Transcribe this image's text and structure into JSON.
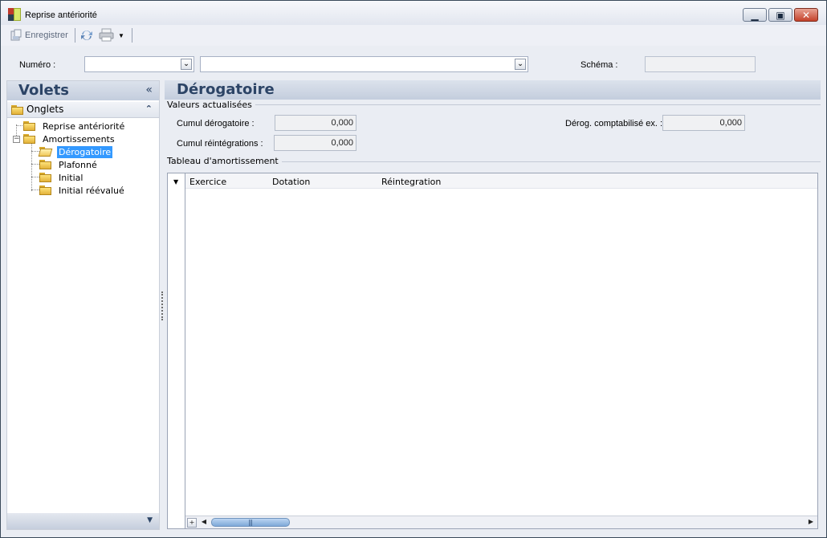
{
  "window": {
    "title": "Reprise antériorité"
  },
  "toolbar": {
    "save_label": "Enregistrer"
  },
  "header": {
    "numero_label": "Numéro :",
    "numero_value": "",
    "numero_desc_value": "",
    "schema_label": "Schéma :",
    "schema_value": ""
  },
  "left_pane": {
    "title": "Volets",
    "collapse_glyph": "«",
    "section_title": "Onglets",
    "section_glyph": "⌃",
    "tree": [
      {
        "label": "Reprise antériorité"
      },
      {
        "label": "Amortissements"
      },
      {
        "label": "Dérogatoire",
        "selected": true
      },
      {
        "label": "Plafonné"
      },
      {
        "label": "Initial"
      },
      {
        "label": "Initial réévalué"
      }
    ]
  },
  "main": {
    "title": "Dérogatoire",
    "valeurs_group": "Valeurs actualisées",
    "cumul_derog_label": "Cumul dérogatoire :",
    "cumul_derog_value": "0,000",
    "derog_compta_label": "Dérog. comptabilisé ex. :",
    "derog_compta_value": "0,000",
    "cumul_reint_label": "Cumul réintégrations :",
    "cumul_reint_value": "0,000",
    "tableau_group": "Tableau d'amortissement",
    "columns": [
      "Exercice",
      "Dotation",
      "Réintegration"
    ]
  },
  "colors": {
    "header_text": "#2c4466",
    "selection": "#3399ff",
    "background": "#eaedf3"
  }
}
